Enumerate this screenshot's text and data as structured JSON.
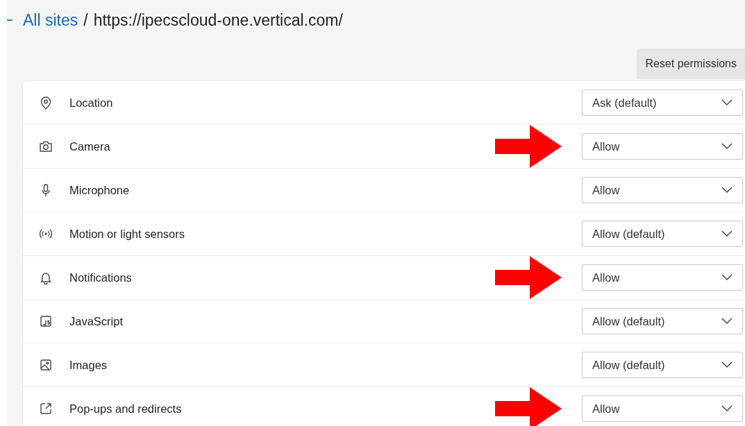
{
  "breadcrumb": {
    "link": "All sites",
    "separator": "/",
    "current": "https://ipecscloud-one.vertical.com/"
  },
  "reset_button": "Reset permissions",
  "permissions": [
    {
      "kind": "location",
      "label": "Location",
      "value": "Ask (default)",
      "arrow": false
    },
    {
      "kind": "camera",
      "label": "Camera",
      "value": "Allow",
      "arrow": true
    },
    {
      "kind": "microphone",
      "label": "Microphone",
      "value": "Allow",
      "arrow": false
    },
    {
      "kind": "sensors",
      "label": "Motion or light sensors",
      "value": "Allow (default)",
      "arrow": false
    },
    {
      "kind": "notifications",
      "label": "Notifications",
      "value": "Allow",
      "arrow": true
    },
    {
      "kind": "javascript",
      "label": "JavaScript",
      "value": "Allow (default)",
      "arrow": false
    },
    {
      "kind": "images",
      "label": "Images",
      "value": "Allow (default)",
      "arrow": false
    },
    {
      "kind": "popups",
      "label": "Pop-ups and redirects",
      "value": "Allow",
      "arrow": true
    }
  ]
}
